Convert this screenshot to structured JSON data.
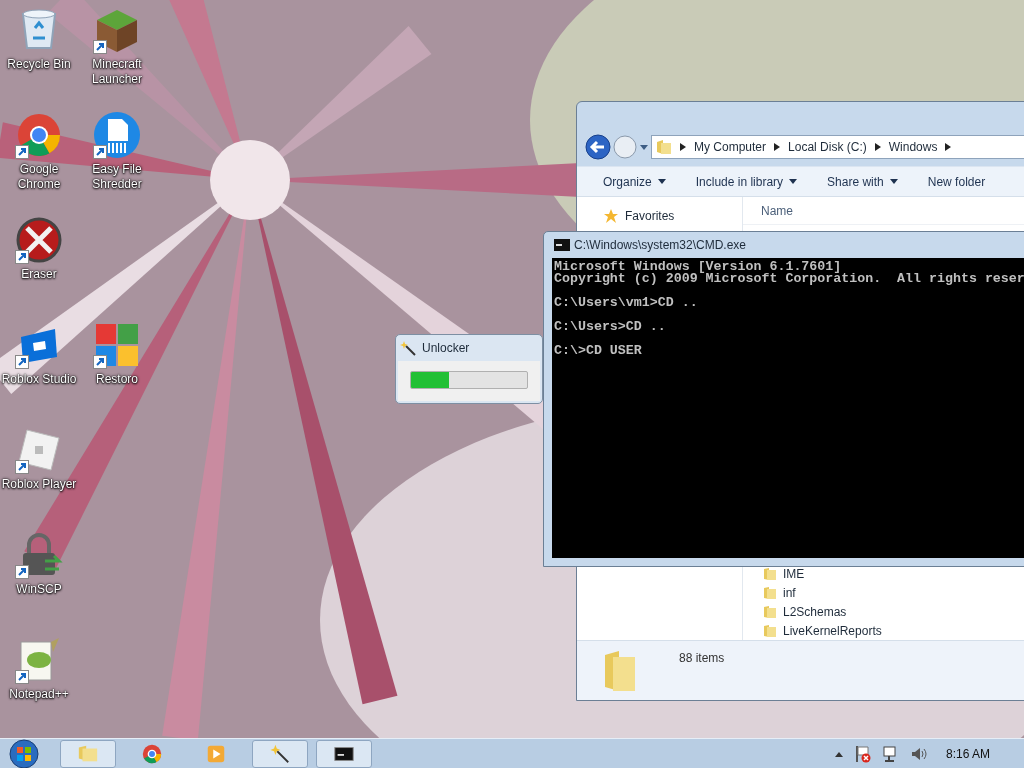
{
  "desktop_icons": [
    {
      "kind": "recycle-bin",
      "label": "Recycle Bin",
      "shortcut": false
    },
    {
      "kind": "minecraft",
      "label": "Minecraft Launcher",
      "shortcut": true
    },
    {
      "kind": "chrome",
      "label": "Google Chrome",
      "shortcut": true
    },
    {
      "kind": "shredder",
      "label": "Easy File Shredder",
      "shortcut": true
    },
    {
      "kind": "eraser",
      "label": "Eraser",
      "shortcut": true
    },
    {
      "kind": "roblox-studio",
      "label": "Roblox Studio",
      "shortcut": true
    },
    {
      "kind": "restoro",
      "label": "Restoro",
      "shortcut": true
    },
    {
      "kind": "roblox-player",
      "label": "Roblox Player",
      "shortcut": true
    },
    {
      "kind": "winscp",
      "label": "WinSCP",
      "shortcut": true
    },
    {
      "kind": "notepad",
      "label": "Notepad++",
      "shortcut": true
    }
  ],
  "explorer": {
    "breadcrumb": [
      "My Computer",
      "Local Disk (C:)",
      "Windows"
    ],
    "toolbar": [
      {
        "label": "Organize",
        "dropdown": true
      },
      {
        "label": "Include in library",
        "dropdown": true
      },
      {
        "label": "Share with",
        "dropdown": true
      },
      {
        "label": "New folder",
        "dropdown": false
      }
    ],
    "sidebar": {
      "items": [
        {
          "label": "Favorites"
        }
      ]
    },
    "columns": [
      "Name"
    ],
    "files": [
      "IME",
      "inf",
      "L2Schemas",
      "LiveKernelReports"
    ],
    "status_bar": "88 items"
  },
  "cmd": {
    "title": "C:\\Windows\\system32\\CMD.exe",
    "output": [
      [
        "Microsoft Windows [Version 6.1.7601]",
        "Copyright (c) 2009 Microsoft Corporation.  All rights reser"
      ],
      [
        "C:\\Users\\vm1>CD .."
      ],
      [
        "C:\\Users>CD .."
      ],
      [
        "C:\\>CD USER"
      ]
    ]
  },
  "unlocker": {
    "title": "Unlocker",
    "level": 0.33
  },
  "taskbar": {
    "items": [
      {
        "kind": "explorer",
        "open": true
      },
      {
        "kind": "chrome",
        "open": false
      },
      {
        "kind": "media",
        "open": false
      },
      {
        "kind": "unlocker",
        "open": true
      },
      {
        "kind": "cmd",
        "open": true
      }
    ],
    "clock": "8:16 AM"
  }
}
